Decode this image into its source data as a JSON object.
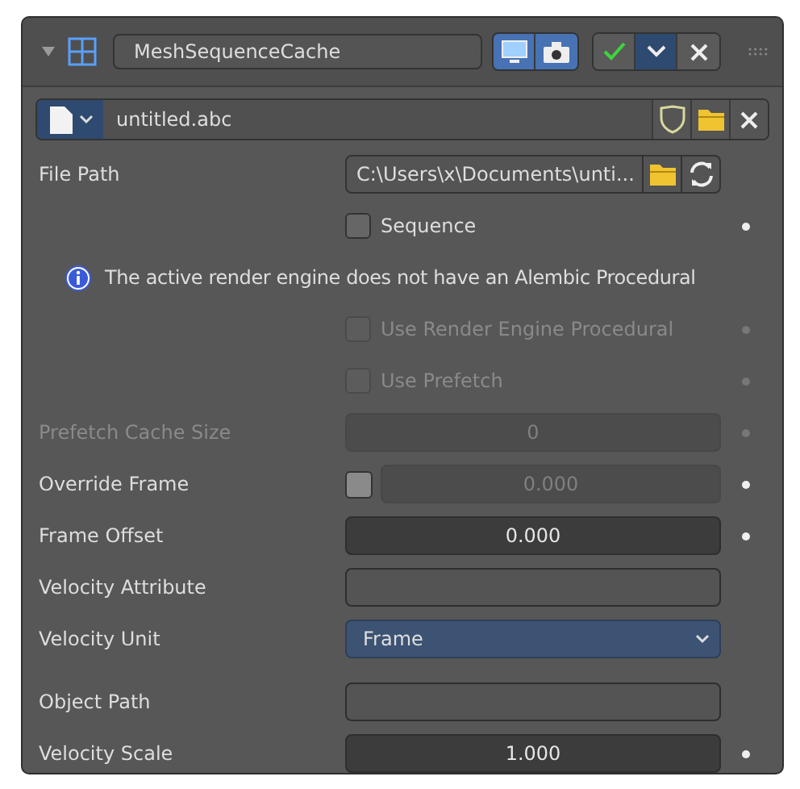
{
  "modifier": {
    "expanded": true,
    "name": "MeshSequenceCache",
    "show_viewport": true,
    "show_render": true
  },
  "cache_file": {
    "name": "untitled.abc"
  },
  "rows": [
    {
      "kind": "path",
      "label": "File Path",
      "value": "C:\\Users\\x\\Documents\\unti...",
      "disabled": false
    },
    {
      "kind": "checkbox",
      "label": "Sequence",
      "checked": false,
      "disabled": false,
      "animatable": true
    },
    {
      "kind": "info",
      "text": "The active render engine does not have an Alembic Procedural"
    },
    {
      "kind": "checkbox",
      "label": "Use Render Engine Procedural",
      "checked": false,
      "disabled": true,
      "animatable": true
    },
    {
      "kind": "checkbox",
      "label": "Use Prefetch",
      "checked": false,
      "disabled": true,
      "animatable": true
    },
    {
      "kind": "number",
      "label": "Prefetch Cache Size",
      "value": "0",
      "disabled": true,
      "animatable": true
    },
    {
      "kind": "check-number",
      "label": "Override Frame",
      "checked": false,
      "value": "0.000",
      "disabled": false,
      "value_disabled": true,
      "animatable": true
    },
    {
      "kind": "number",
      "label": "Frame Offset",
      "value": "0.000",
      "disabled": false,
      "animatable": true
    },
    {
      "kind": "text",
      "label": "Velocity Attribute",
      "disabled": false,
      "animatable": false
    },
    {
      "kind": "dropdown",
      "label": "Velocity Unit",
      "value": "Frame",
      "disabled": false,
      "animatable": false
    },
    {
      "kind": "text",
      "label": "Object Path",
      "disabled": false,
      "animatable": false
    },
    {
      "kind": "number",
      "label": "Velocity Scale",
      "value": "1.000",
      "disabled": false,
      "animatable": true
    }
  ]
}
